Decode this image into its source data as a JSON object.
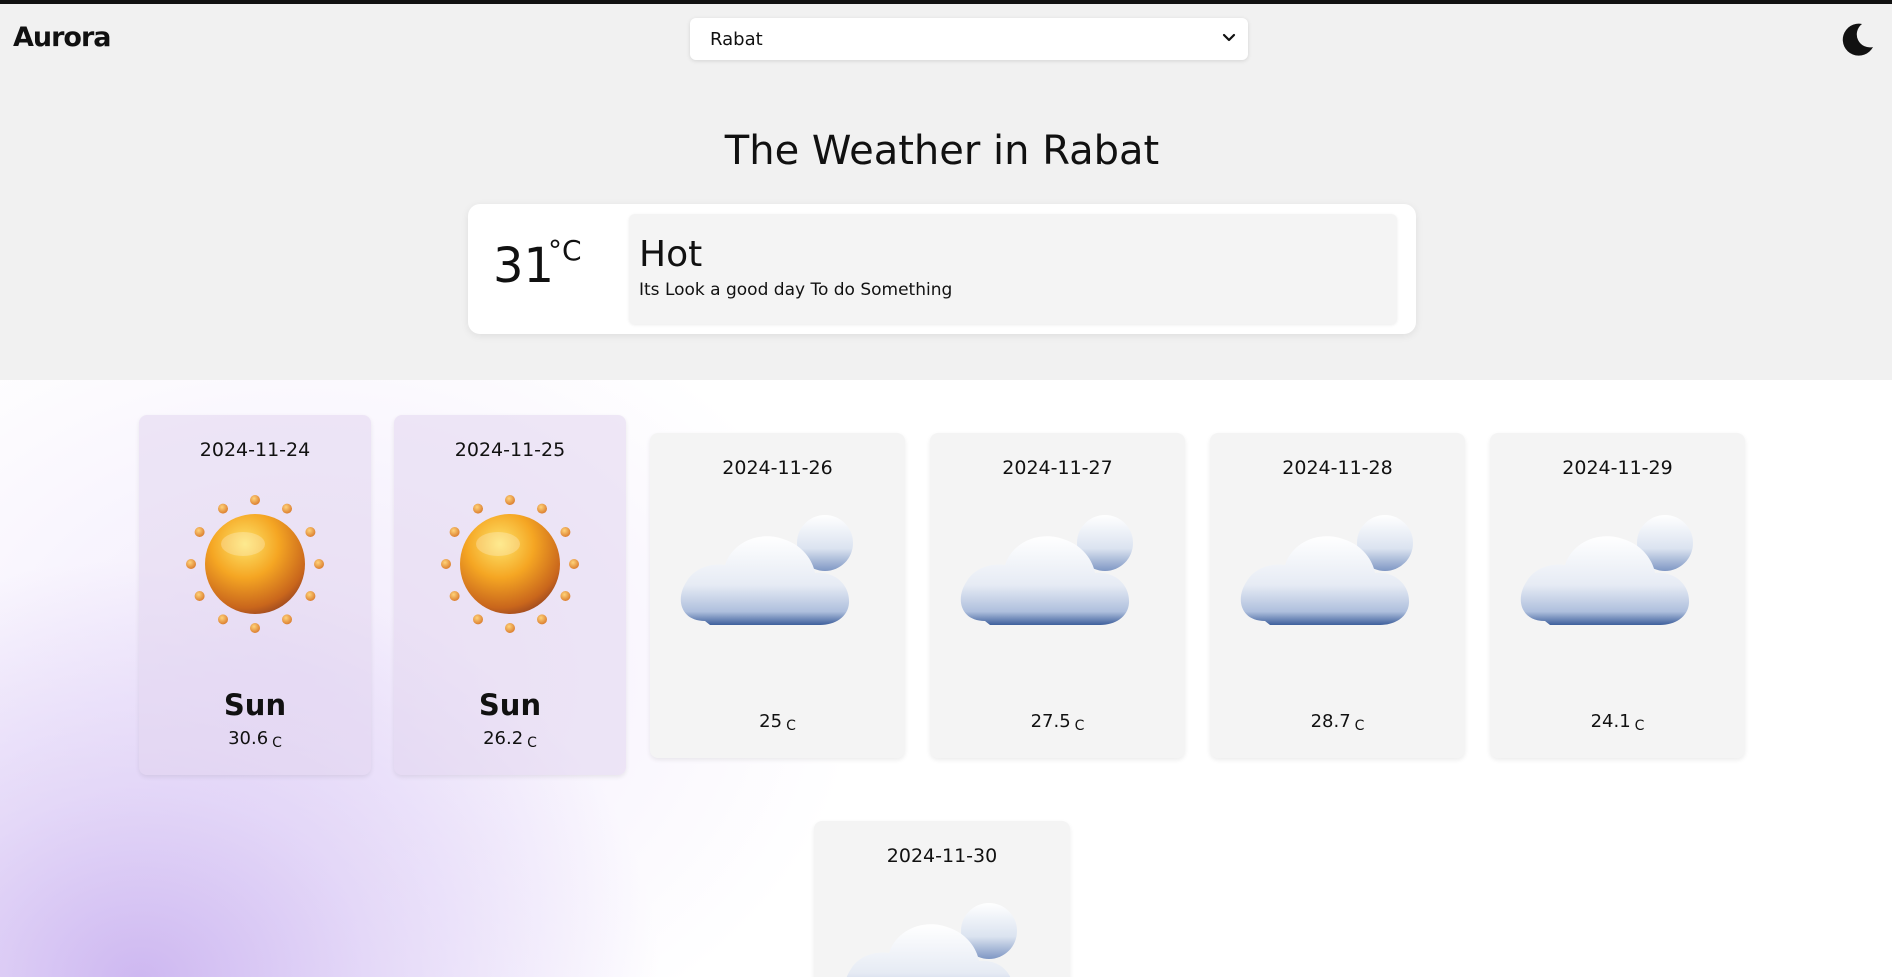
{
  "app": {
    "logo": "Aurora"
  },
  "header": {
    "city_select": {
      "selected": "Rabat"
    },
    "theme_toggle_icon": "moon-icon"
  },
  "main": {
    "title": "The Weather in Rabat",
    "current": {
      "temperature": "31",
      "unit": "°C",
      "condition": "Hot",
      "message": "Its Look a good day To do Something"
    }
  },
  "forecast": [
    {
      "date": "2024-11-24",
      "icon": "sun-icon",
      "label": "Sun",
      "temp": "30.6",
      "unit": "C"
    },
    {
      "date": "2024-11-25",
      "icon": "sun-icon",
      "label": "Sun",
      "temp": "26.2",
      "unit": "C"
    },
    {
      "date": "2024-11-26",
      "icon": "cloud-icon",
      "label": "",
      "temp": "25",
      "unit": "C"
    },
    {
      "date": "2024-11-27",
      "icon": "cloud-icon",
      "label": "",
      "temp": "27.5",
      "unit": "C"
    },
    {
      "date": "2024-11-28",
      "icon": "cloud-icon",
      "label": "",
      "temp": "28.7",
      "unit": "C"
    },
    {
      "date": "2024-11-29",
      "icon": "cloud-icon",
      "label": "",
      "temp": "24.1",
      "unit": "C"
    },
    {
      "date": "2024-11-30",
      "icon": "cloud-icon",
      "label": "",
      "temp": "",
      "unit": ""
    }
  ],
  "colors": {
    "sun_core": "#f5a623",
    "sun_ray": "#e8892a",
    "cloud": "#dfe6f2",
    "cloud_shadow": "#3e5f9c",
    "accent_purple": "#cbb4f0"
  }
}
